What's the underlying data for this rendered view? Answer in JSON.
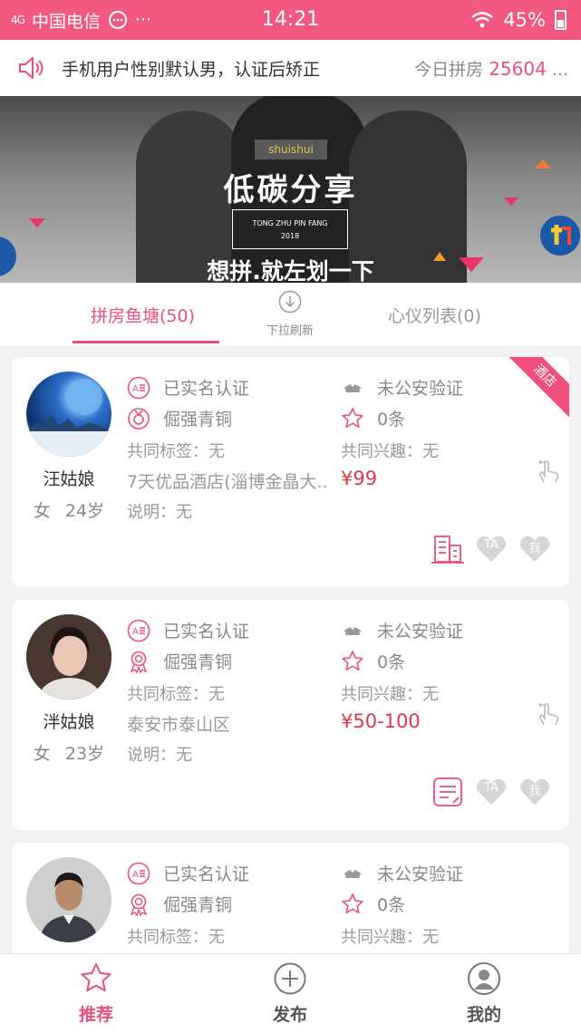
{
  "status_bar": {
    "signal": "4G",
    "carrier": "中国电信",
    "extra": "···",
    "time": "14:21",
    "battery": "45%"
  },
  "notice": {
    "message": "手机用户性别默认男，认证后矫正",
    "today_label": "今日拼房",
    "today_count": "25604",
    "more": "..."
  },
  "banner": {
    "tag": "shuishui",
    "title": "低碳分享",
    "sub_line1": "TONG ZHU PIN FANG",
    "sub_line2": "2018",
    "slogan": "想拼.就左划一下"
  },
  "tabs": {
    "pond": "拼房鱼塘(50)",
    "refresh": "下拉刷新",
    "list": "心仪列表(0)"
  },
  "cards": [
    {
      "name": "汪姑娘",
      "gender": "女",
      "age": "24岁",
      "verify": "已实名认证",
      "police": "未公安验证",
      "level": "倔强青铜",
      "count": "0条",
      "tags": "共同标签：无",
      "interests": "共同兴趣：无",
      "location": "7天优品酒店(淄博金晶大..",
      "price": "¥99",
      "note": "说明：无",
      "ribbon": "酒店",
      "btn_ta": "TA",
      "btn_me": "我"
    },
    {
      "name": "泮姑娘",
      "gender": "女",
      "age": "23岁",
      "verify": "已实名认证",
      "police": "未公安验证",
      "level": "倔强青铜",
      "count": "0条",
      "tags": "共同标签：无",
      "interests": "共同兴趣：无",
      "location": "泰安市泰山区",
      "price": "¥50-100",
      "note": "说明：无",
      "btn_ta": "TA",
      "btn_me": "我"
    },
    {
      "verify": "已实名认证",
      "police": "未公安验证",
      "level": "倔强青铜",
      "count": "0条",
      "tags": "共同标签：无",
      "interests": "共同兴趣：无"
    }
  ],
  "bottom_nav": {
    "recommend": "推荐",
    "publish": "发布",
    "mine": "我的"
  },
  "colors": {
    "accent": "#ea4f7b",
    "status_bar": "#f2587f",
    "price": "#d9394e"
  }
}
